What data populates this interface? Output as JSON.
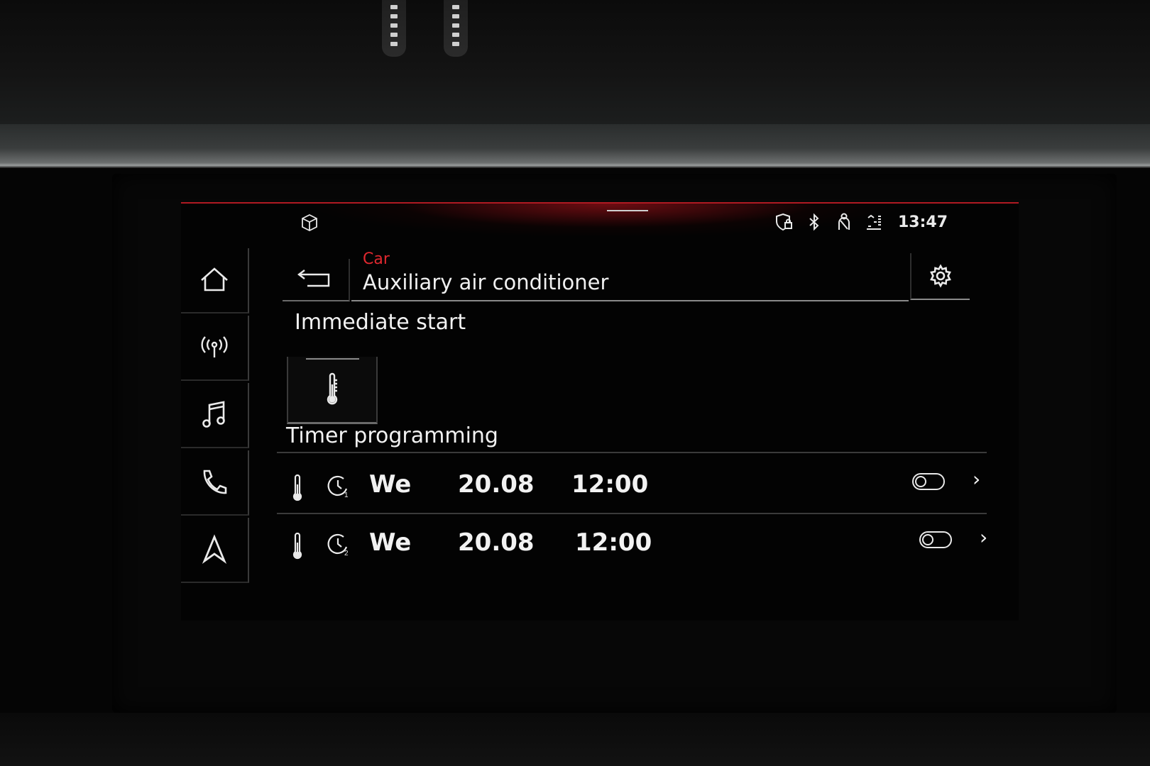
{
  "status_bar": {
    "time": "13:47",
    "icons": [
      "shield-lock-icon",
      "bluetooth-icon",
      "seat-belt-icon",
      "data-signal-icon"
    ]
  },
  "top_left_icon": "cube-icon",
  "nav_rail": [
    {
      "name": "home",
      "icon": "home-icon"
    },
    {
      "name": "radio",
      "icon": "antenna-icon"
    },
    {
      "name": "media",
      "icon": "music-note-icon"
    },
    {
      "name": "phone",
      "icon": "phone-icon"
    },
    {
      "name": "navigation",
      "icon": "navigation-arrow-icon"
    }
  ],
  "header": {
    "breadcrumb": "Car",
    "title": "Auxiliary air conditioner"
  },
  "immediate_start": {
    "heading": "Immediate start",
    "button_icon": "thermometer-icon"
  },
  "timer_programming": {
    "heading": "Timer programming",
    "timers": [
      {
        "slot_icon": "clock-1-icon",
        "day": "We",
        "date": "20.08",
        "time": "12:00",
        "enabled": false
      },
      {
        "slot_icon": "clock-2-icon",
        "day": "We",
        "date": "20.08",
        "time": "12:00",
        "enabled": false
      }
    ]
  },
  "colors": {
    "accent_red": "#e0282f",
    "text": "#f2f2f2",
    "background": "#030303"
  }
}
